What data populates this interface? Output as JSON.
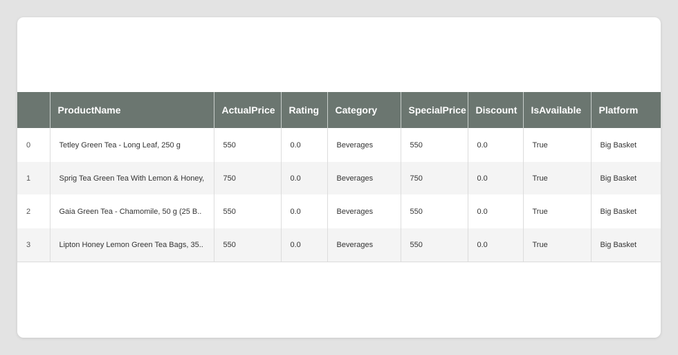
{
  "table": {
    "columns": [
      "",
      "ProductName",
      "ActualPrice",
      "Rating",
      "Category",
      "SpecialPrice",
      "Discount",
      "IsAvailable",
      "Platform"
    ],
    "rows": [
      {
        "index": "0",
        "ProductName": "Tetley Green Tea - Long Leaf, 250 g",
        "ActualPrice": "550",
        "Rating": "0.0",
        "Category": "Beverages",
        "SpecialPrice": "550",
        "Discount": "0.0",
        "IsAvailable": "True",
        "Platform": "Big Basket"
      },
      {
        "index": "1",
        "ProductName": "Sprig Tea Green Tea With Lemon & Honey,",
        "ActualPrice": "750",
        "Rating": "0.0",
        "Category": "Beverages",
        "SpecialPrice": "750",
        "Discount": "0.0",
        "IsAvailable": "True",
        "Platform": "Big Basket"
      },
      {
        "index": "2",
        "ProductName": "Gaia Green Tea - Chamomile, 50 g (25 B..",
        "ActualPrice": "550",
        "Rating": "0.0",
        "Category": "Beverages",
        "SpecialPrice": "550",
        "Discount": "0.0",
        "IsAvailable": "True",
        "Platform": "Big Basket"
      },
      {
        "index": "3",
        "ProductName": "Lipton Honey Lemon Green Tea Bags, 35..",
        "ActualPrice": "550",
        "Rating": "0.0",
        "Category": "Beverages",
        "SpecialPrice": "550",
        "Discount": "0.0",
        "IsAvailable": "True",
        "Platform": "Big Basket"
      }
    ]
  },
  "colors": {
    "header_bg": "#6b7670",
    "page_bg": "#e3e3e3",
    "card_bg": "#ffffff",
    "row_alt_bg": "#f4f4f4"
  }
}
